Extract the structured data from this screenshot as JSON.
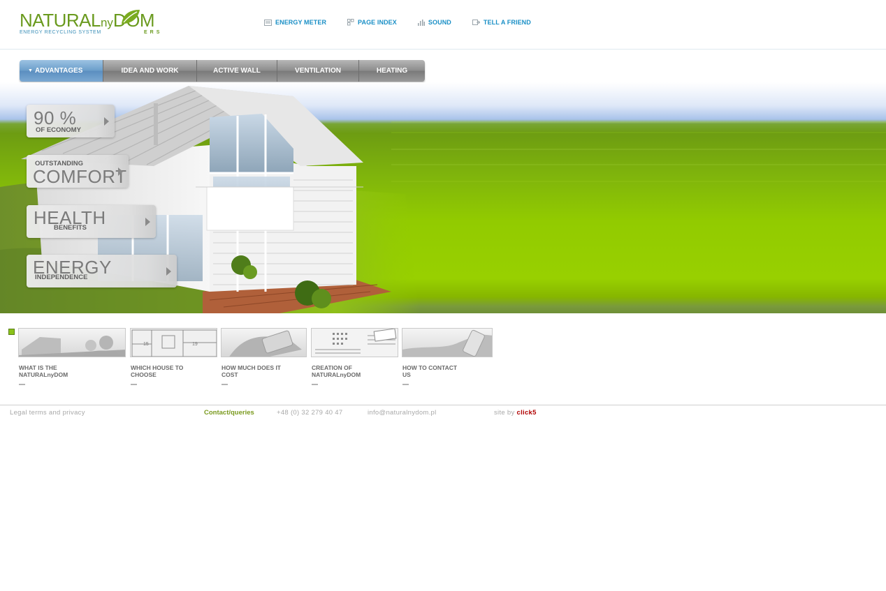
{
  "brand": {
    "logo_main": "NATURAL",
    "logo_ny": "ny",
    "logo_dom": "DOM",
    "logo_sub": "ENERGY RECYCLING SYSTEM",
    "logo_ers": "ERS",
    "logo_color": "#6a9a1e",
    "logo_sub_color": "#3b8fb8"
  },
  "top_links": [
    {
      "label": "ENERGY METER",
      "icon": "energy-meter-icon"
    },
    {
      "label": "PAGE INDEX",
      "icon": "page-index-icon"
    },
    {
      "label": "SOUND",
      "icon": "sound-icon"
    },
    {
      "label": "TELL A FRIEND",
      "icon": "tell-a-friend-icon"
    }
  ],
  "nav": {
    "active_tab": "ADVANTAGES",
    "tabs": [
      {
        "label": "ADVANTAGES"
      },
      {
        "label": "IDEA AND WORK"
      },
      {
        "label": "ACTIVE WALL"
      },
      {
        "label": "VENTILATION"
      },
      {
        "label": "HEATING"
      }
    ]
  },
  "advantages": [
    {
      "big": "90 %",
      "small": "OF ECONOMY"
    },
    {
      "small": "OUTSTANDING",
      "big": "COMFORT"
    },
    {
      "big": "HEALTH",
      "small": "BENEFITS"
    },
    {
      "big": "ENERGY",
      "small": "INDEPENDENCE"
    }
  ],
  "thumbnails": [
    {
      "label": "WHAT IS THE\nNATURALnyDOM"
    },
    {
      "label": "WHICH HOUSE TO\nCHOOSE"
    },
    {
      "label": "HOW MUCH DOES IT\nCOST"
    },
    {
      "label": "CREATION OF\nNATURALnyDOM"
    },
    {
      "label": "HOW TO CONTACT\nUS"
    }
  ],
  "footer": {
    "legal": "Legal terms and privacy",
    "contact": "Contact/queries",
    "phone": "+48 (0) 32 279 40 47",
    "email": "info@naturalnydom.pl",
    "site_by": "site by",
    "site_brand": "click5"
  },
  "colors": {
    "accent_blue": "#1a8fc6",
    "nav_active": "#6c9fcb",
    "hero_green": "#92cb00",
    "contact_green": "#7a9a1e",
    "click5_red": "#b00000"
  }
}
